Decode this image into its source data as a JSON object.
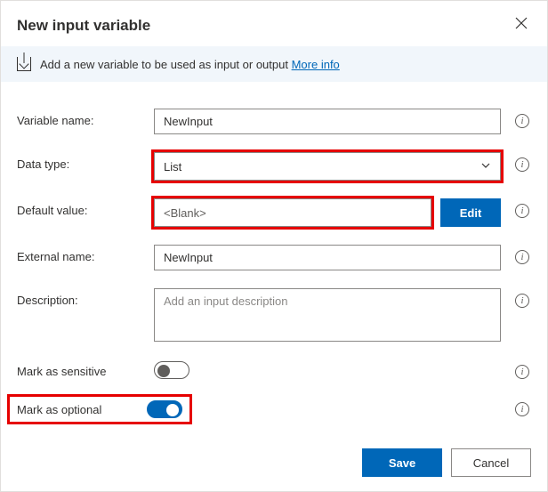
{
  "dialog": {
    "title": "New input variable",
    "banner_text": "Add a new variable to be used as input or output",
    "banner_link": "More info"
  },
  "labels": {
    "variable_name": "Variable name:",
    "data_type": "Data type:",
    "default_value": "Default value:",
    "external_name": "External name:",
    "description": "Description:",
    "mark_sensitive": "Mark as sensitive",
    "mark_optional": "Mark as optional"
  },
  "fields": {
    "variable_name_value": "NewInput",
    "data_type_value": "List",
    "default_value_value": "<Blank>",
    "external_name_value": "NewInput",
    "description_placeholder": "Add an input description",
    "mark_sensitive_on": false,
    "mark_optional_on": true
  },
  "buttons": {
    "edit": "Edit",
    "save": "Save",
    "cancel": "Cancel"
  },
  "glyphs": {
    "info": "i"
  }
}
